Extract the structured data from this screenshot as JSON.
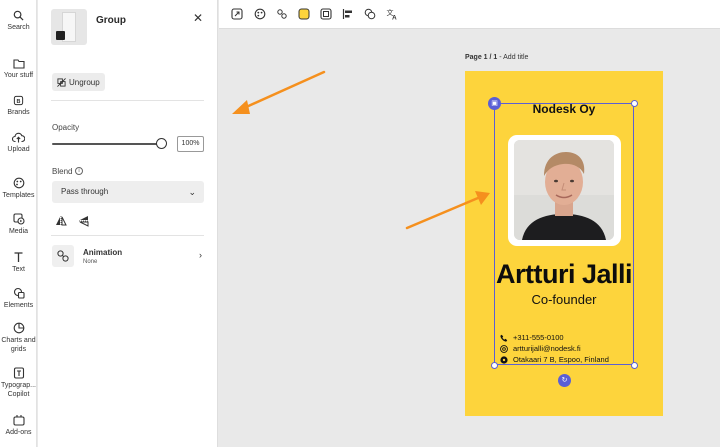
{
  "rail": {
    "items": [
      {
        "label": "Search",
        "icon": "search-icon"
      },
      {
        "label": "Your stuff",
        "icon": "folder-icon"
      },
      {
        "label": "Brands",
        "icon": "brand-icon"
      },
      {
        "label": "Upload",
        "icon": "upload-cloud-icon"
      },
      {
        "label": "Templates",
        "icon": "templates-icon"
      },
      {
        "label": "Media",
        "icon": "media-icon"
      },
      {
        "label": "Text",
        "icon": "text-icon"
      },
      {
        "label": "Elements",
        "icon": "shapes-icon"
      },
      {
        "label": "Charts and grids",
        "icon": "chart-icon"
      },
      {
        "label": "Typograp... Copilot",
        "icon": "typography-icon"
      },
      {
        "label": "Add-ons",
        "icon": "addons-icon"
      }
    ]
  },
  "panel": {
    "title": "Group",
    "ungroup_label": "Ungroup",
    "opacity_label": "Opacity",
    "opacity_value": "100%",
    "opacity_level": 1.0,
    "blend_label": "Blend",
    "blend_value": "Pass through",
    "animation_title": "Animation",
    "animation_value": "None"
  },
  "canvas": {
    "page_label_bold": "Page 1 / 1",
    "page_label_rest": " - Add title",
    "card": {
      "company": "Nodesk Oy",
      "name": "Artturi Jalli",
      "role": "Co-founder",
      "phone": "+311-555-0100",
      "email": "artturijalli@nodesk.fi",
      "address": "Otakaari 7 B, Espoo, Finland"
    }
  },
  "colors": {
    "card_background": "#fdd43c",
    "selection": "#5b5fd6",
    "annotation_arrow": "#f5901e"
  }
}
